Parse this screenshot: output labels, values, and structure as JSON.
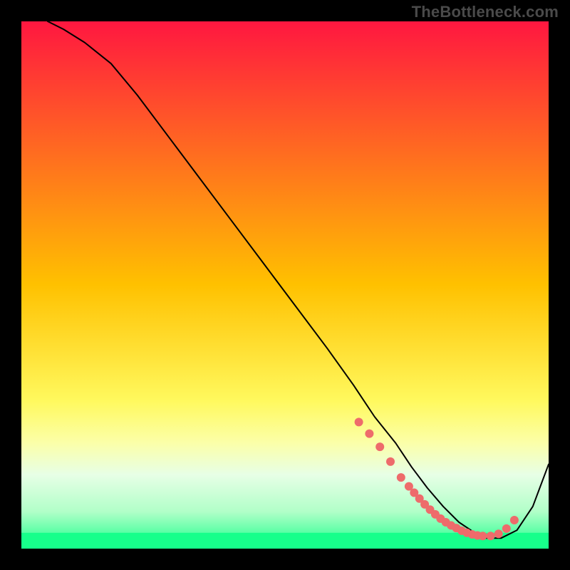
{
  "watermark": "TheBottleneck.com",
  "chart_data": {
    "type": "line",
    "title": "",
    "xlabel": "",
    "ylabel": "",
    "xlim": [
      0,
      100
    ],
    "ylim": [
      0,
      100
    ],
    "grid": false,
    "legend": false,
    "background": {
      "type": "vertical-gradient",
      "stops": [
        {
          "offset": 0.0,
          "color": "#ff1740"
        },
        {
          "offset": 0.5,
          "color": "#ffc100"
        },
        {
          "offset": 0.72,
          "color": "#fff95e"
        },
        {
          "offset": 0.8,
          "color": "#fbffa9"
        },
        {
          "offset": 0.86,
          "color": "#e7ffe6"
        },
        {
          "offset": 0.93,
          "color": "#b1ffc8"
        },
        {
          "offset": 1.0,
          "color": "#17ff8b"
        }
      ],
      "green_band_y_fraction": 0.97
    },
    "series": [
      {
        "name": "curve",
        "color": "#000000",
        "stroke_width": 2,
        "x": [
          5,
          8,
          12,
          17,
          22,
          28,
          34,
          40,
          46,
          52,
          58,
          63,
          67,
          71,
          74,
          77,
          80,
          83,
          86,
          88,
          91,
          94,
          97,
          100
        ],
        "y": [
          100,
          98.5,
          96,
          92,
          86,
          78,
          70,
          62,
          54,
          46,
          38,
          31,
          25,
          20,
          15.5,
          11.5,
          8,
          5,
          3,
          2,
          2,
          3.5,
          8,
          16
        ]
      }
    ],
    "markers": {
      "name": "dots",
      "color": "#ee6b6b",
      "radius": 6,
      "x": [
        64,
        66,
        68,
        70,
        72,
        73.5,
        74.5,
        75.5,
        76.5,
        77.5,
        78.5,
        79.5,
        80.5,
        81.5,
        82.5,
        83.5,
        84.5,
        85.5,
        86.5,
        87.5,
        89,
        90.5,
        92,
        93.5
      ],
      "y": [
        24,
        21.8,
        19.3,
        16.5,
        13.5,
        11.8,
        10.6,
        9.5,
        8.4,
        7.4,
        6.5,
        5.7,
        5.0,
        4.4,
        3.9,
        3.4,
        3.0,
        2.7,
        2.5,
        2.4,
        2.4,
        2.8,
        3.8,
        5.4
      ]
    }
  }
}
